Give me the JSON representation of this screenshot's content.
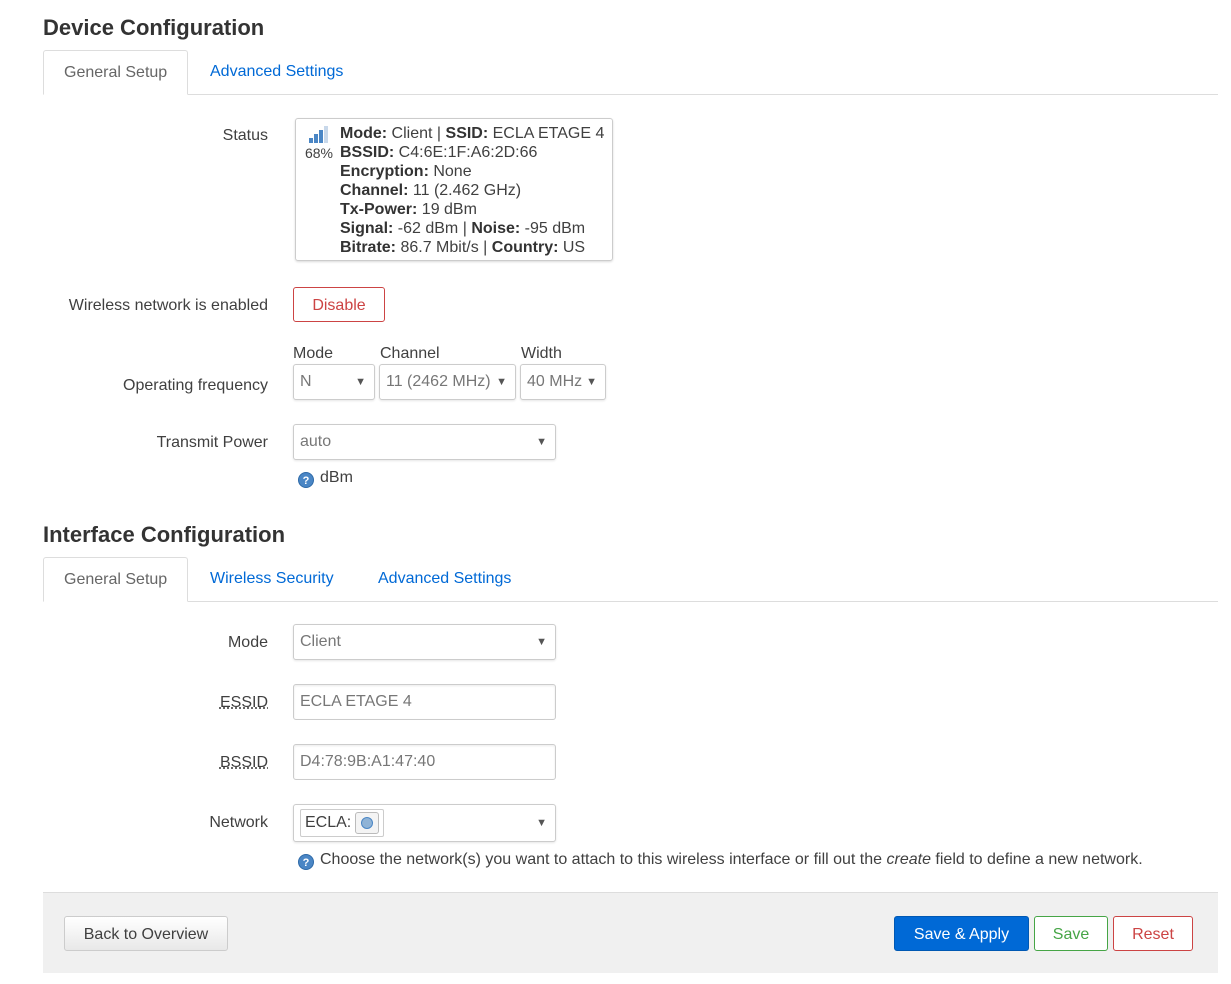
{
  "device": {
    "title": "Device Configuration",
    "tabs": [
      "General Setup",
      "Advanced Settings"
    ],
    "status_label": "Status",
    "status": {
      "signal_percent": "68%",
      "mode_k": "Mode:",
      "mode_v": " Client | ",
      "ssid_k": "SSID:",
      "ssid_v": " ECLA ETAGE 4",
      "bssid_k": "BSSID:",
      "bssid_v": " C4:6E:1F:A6:2D:66",
      "enc_k": "Encryption:",
      "enc_v": " None",
      "chan_k": "Channel:",
      "chan_v": " 11 (2.462 GHz)",
      "tx_k": "Tx-Power:",
      "tx_v": " 19 dBm",
      "sig_k": "Signal:",
      "sig_v": " -62 dBm | ",
      "noise_k": "Noise:",
      "noise_v": " -95 dBm",
      "bitrate_k": "Bitrate:",
      "bitrate_v": " 86.7 Mbit/s | ",
      "country_k": "Country:",
      "country_v": " US"
    },
    "enabled_label": "Wireless network is enabled",
    "disable_button": "Disable",
    "freq_label": "Operating frequency",
    "mode_header": "Mode",
    "channel_header": "Channel",
    "width_header": "Width",
    "mode_value": "N",
    "channel_value": "11 (2462 MHz)",
    "width_value": "40 MHz",
    "txpower_label": "Transmit Power",
    "txpower_value": "auto",
    "txpower_help": "dBm"
  },
  "interface": {
    "title": "Interface Configuration",
    "tabs": [
      "General Setup",
      "Wireless Security",
      "Advanced Settings"
    ],
    "mode_label": "Mode",
    "mode_value": "Client",
    "essid_label": "ESSID",
    "essid_value": "ECLA ETAGE 4",
    "bssid_label": "BSSID",
    "bssid_value": "D4:78:9B:A1:47:40",
    "network_label": "Network",
    "network_value": "ECLA:",
    "network_help_pre": "Choose the network(s) you want to attach to this wireless interface or fill out the ",
    "network_help_em": "create",
    "network_help_post": " field to define a new network."
  },
  "footer": {
    "back": "Back to Overview",
    "save_apply": "Save & Apply",
    "save": "Save",
    "reset": "Reset"
  }
}
